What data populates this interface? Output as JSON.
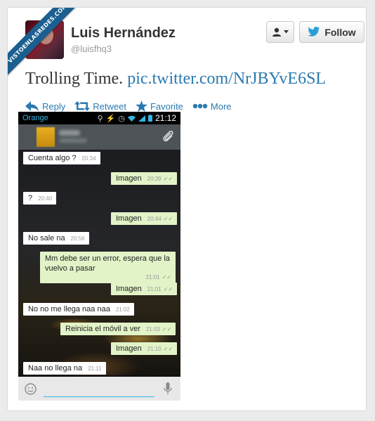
{
  "ribbon": {
    "text": "VISTOENLASREDES.COM"
  },
  "user": {
    "name": "Luis Hernández",
    "handle": "@luisfhq3"
  },
  "buttons": {
    "follow_label": "Follow"
  },
  "tweet": {
    "text": "Trolling Time. ",
    "link": "pic.twitter.com/NrJBYvE6SL"
  },
  "actions": [
    {
      "label": "Reply",
      "icon": "reply-icon"
    },
    {
      "label": "Retweet",
      "icon": "retweet-icon"
    },
    {
      "label": "Favorite",
      "icon": "star-icon"
    },
    {
      "label": "More",
      "icon": "more-dots-icon"
    }
  ],
  "phone": {
    "carrier": "Orange",
    "time": "21:12",
    "messages": [
      {
        "dir": "recv",
        "text": "Cuenta algo ?",
        "time": "20:34"
      },
      {
        "dir": "sent",
        "text": "Imagen",
        "time": "20:39"
      },
      {
        "dir": "recv",
        "text": "?",
        "time": "20:40"
      },
      {
        "dir": "sent",
        "text": "Imagen",
        "time": "20:44"
      },
      {
        "dir": "recv",
        "text": "No sale na",
        "time": "20:56"
      },
      {
        "dir": "sent",
        "text": "Mm debe ser un error, espera que la vuelvo a pasar",
        "time": "21:01"
      },
      {
        "dir": "sent",
        "text": "Imagen",
        "time": "21:01"
      },
      {
        "dir": "recv",
        "text": "No no me llega naa naa",
        "time": "21:02"
      },
      {
        "dir": "sent",
        "text": "Reinicia el móvil a ver",
        "time": "21:03"
      },
      {
        "dir": "sent",
        "text": "Imagen",
        "time": "21:10"
      },
      {
        "dir": "recv",
        "text": "Naa no llega na",
        "time": "21:11"
      }
    ]
  },
  "colors": {
    "link": "#2a7ab0",
    "sent_bubble": "#e2f3c8",
    "recv_bubble": "#ffffff",
    "android_accent": "#33b5e5"
  }
}
